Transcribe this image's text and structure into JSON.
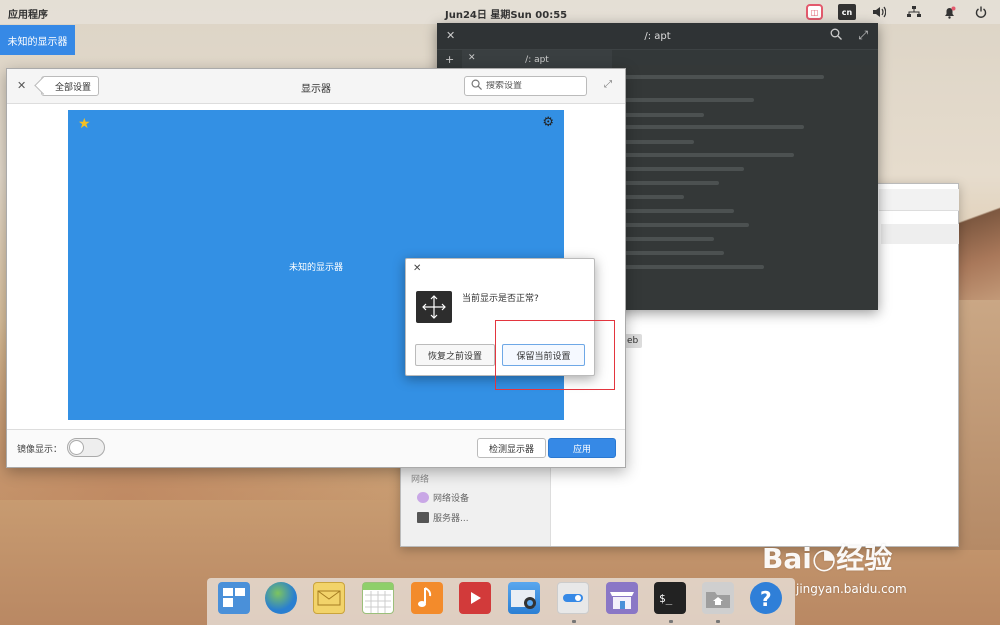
{
  "top_panel": {
    "applications_label": "应用程序",
    "clock": "Jun24日 星期Sun    00:55",
    "keyboard_layout": "cn",
    "icons": [
      "app-indicator-icon",
      "keyboard-layout-icon",
      "volume-icon",
      "network-icon",
      "notifications-icon",
      "power-icon"
    ]
  },
  "display_tag": "未知的显示器",
  "terminal": {
    "title": "/: apt",
    "tab_label": "/: apt"
  },
  "background_window": {
    "section": "网络",
    "items": [
      "网络设备",
      "服务器..."
    ],
    "partial_label": "eb"
  },
  "settings": {
    "back_label": "全部设置",
    "title": "显示器",
    "search_placeholder": "搜索设置",
    "display_name": "未知的显示器",
    "mirror_label": "镜像显示：",
    "detect_button": "检测显示器",
    "apply_button": "应用"
  },
  "dialog": {
    "message": "当前显示是否正常?",
    "revert_button": "恢复之前设置",
    "keep_button": "保留当前设置"
  },
  "dock": {
    "apps": [
      "multitasking-view",
      "web-browser",
      "mail",
      "calendar",
      "music",
      "videos",
      "photos",
      "system-settings",
      "appcenter",
      "terminal",
      "files",
      "help"
    ],
    "colors": {
      "multitasking": "#4a90d9",
      "browser": "#3a8fd6",
      "mail": "#f2d36a",
      "calendar": "#8fcf6a",
      "music": "#f38b2b",
      "videos": "#d23a3a",
      "photos": "#2b7fd4",
      "settings": "#e8e8e8",
      "appcenter": "#8a77c6",
      "terminal": "#222222",
      "files": "#b9b9b9",
      "help": "#2f7fd8"
    }
  },
  "colors": {
    "accent": "#3689e6",
    "display_preview": "#3390e4",
    "highlight": "#e3353e"
  }
}
